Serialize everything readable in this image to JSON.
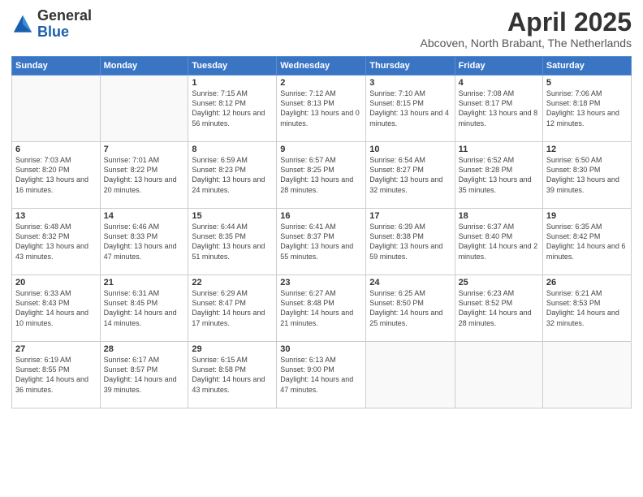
{
  "header": {
    "logo_general": "General",
    "logo_blue": "Blue",
    "title": "April 2025",
    "subtitle": "Abcoven, North Brabant, The Netherlands"
  },
  "days_of_week": [
    "Sunday",
    "Monday",
    "Tuesday",
    "Wednesday",
    "Thursday",
    "Friday",
    "Saturday"
  ],
  "weeks": [
    [
      {
        "day": "",
        "info": ""
      },
      {
        "day": "",
        "info": ""
      },
      {
        "day": "1",
        "info": "Sunrise: 7:15 AM\nSunset: 8:12 PM\nDaylight: 12 hours and 56 minutes."
      },
      {
        "day": "2",
        "info": "Sunrise: 7:12 AM\nSunset: 8:13 PM\nDaylight: 13 hours and 0 minutes."
      },
      {
        "day": "3",
        "info": "Sunrise: 7:10 AM\nSunset: 8:15 PM\nDaylight: 13 hours and 4 minutes."
      },
      {
        "day": "4",
        "info": "Sunrise: 7:08 AM\nSunset: 8:17 PM\nDaylight: 13 hours and 8 minutes."
      },
      {
        "day": "5",
        "info": "Sunrise: 7:06 AM\nSunset: 8:18 PM\nDaylight: 13 hours and 12 minutes."
      }
    ],
    [
      {
        "day": "6",
        "info": "Sunrise: 7:03 AM\nSunset: 8:20 PM\nDaylight: 13 hours and 16 minutes."
      },
      {
        "day": "7",
        "info": "Sunrise: 7:01 AM\nSunset: 8:22 PM\nDaylight: 13 hours and 20 minutes."
      },
      {
        "day": "8",
        "info": "Sunrise: 6:59 AM\nSunset: 8:23 PM\nDaylight: 13 hours and 24 minutes."
      },
      {
        "day": "9",
        "info": "Sunrise: 6:57 AM\nSunset: 8:25 PM\nDaylight: 13 hours and 28 minutes."
      },
      {
        "day": "10",
        "info": "Sunrise: 6:54 AM\nSunset: 8:27 PM\nDaylight: 13 hours and 32 minutes."
      },
      {
        "day": "11",
        "info": "Sunrise: 6:52 AM\nSunset: 8:28 PM\nDaylight: 13 hours and 35 minutes."
      },
      {
        "day": "12",
        "info": "Sunrise: 6:50 AM\nSunset: 8:30 PM\nDaylight: 13 hours and 39 minutes."
      }
    ],
    [
      {
        "day": "13",
        "info": "Sunrise: 6:48 AM\nSunset: 8:32 PM\nDaylight: 13 hours and 43 minutes."
      },
      {
        "day": "14",
        "info": "Sunrise: 6:46 AM\nSunset: 8:33 PM\nDaylight: 13 hours and 47 minutes."
      },
      {
        "day": "15",
        "info": "Sunrise: 6:44 AM\nSunset: 8:35 PM\nDaylight: 13 hours and 51 minutes."
      },
      {
        "day": "16",
        "info": "Sunrise: 6:41 AM\nSunset: 8:37 PM\nDaylight: 13 hours and 55 minutes."
      },
      {
        "day": "17",
        "info": "Sunrise: 6:39 AM\nSunset: 8:38 PM\nDaylight: 13 hours and 59 minutes."
      },
      {
        "day": "18",
        "info": "Sunrise: 6:37 AM\nSunset: 8:40 PM\nDaylight: 14 hours and 2 minutes."
      },
      {
        "day": "19",
        "info": "Sunrise: 6:35 AM\nSunset: 8:42 PM\nDaylight: 14 hours and 6 minutes."
      }
    ],
    [
      {
        "day": "20",
        "info": "Sunrise: 6:33 AM\nSunset: 8:43 PM\nDaylight: 14 hours and 10 minutes."
      },
      {
        "day": "21",
        "info": "Sunrise: 6:31 AM\nSunset: 8:45 PM\nDaylight: 14 hours and 14 minutes."
      },
      {
        "day": "22",
        "info": "Sunrise: 6:29 AM\nSunset: 8:47 PM\nDaylight: 14 hours and 17 minutes."
      },
      {
        "day": "23",
        "info": "Sunrise: 6:27 AM\nSunset: 8:48 PM\nDaylight: 14 hours and 21 minutes."
      },
      {
        "day": "24",
        "info": "Sunrise: 6:25 AM\nSunset: 8:50 PM\nDaylight: 14 hours and 25 minutes."
      },
      {
        "day": "25",
        "info": "Sunrise: 6:23 AM\nSunset: 8:52 PM\nDaylight: 14 hours and 28 minutes."
      },
      {
        "day": "26",
        "info": "Sunrise: 6:21 AM\nSunset: 8:53 PM\nDaylight: 14 hours and 32 minutes."
      }
    ],
    [
      {
        "day": "27",
        "info": "Sunrise: 6:19 AM\nSunset: 8:55 PM\nDaylight: 14 hours and 36 minutes."
      },
      {
        "day": "28",
        "info": "Sunrise: 6:17 AM\nSunset: 8:57 PM\nDaylight: 14 hours and 39 minutes."
      },
      {
        "day": "29",
        "info": "Sunrise: 6:15 AM\nSunset: 8:58 PM\nDaylight: 14 hours and 43 minutes."
      },
      {
        "day": "30",
        "info": "Sunrise: 6:13 AM\nSunset: 9:00 PM\nDaylight: 14 hours and 47 minutes."
      },
      {
        "day": "",
        "info": ""
      },
      {
        "day": "",
        "info": ""
      },
      {
        "day": "",
        "info": ""
      }
    ]
  ]
}
